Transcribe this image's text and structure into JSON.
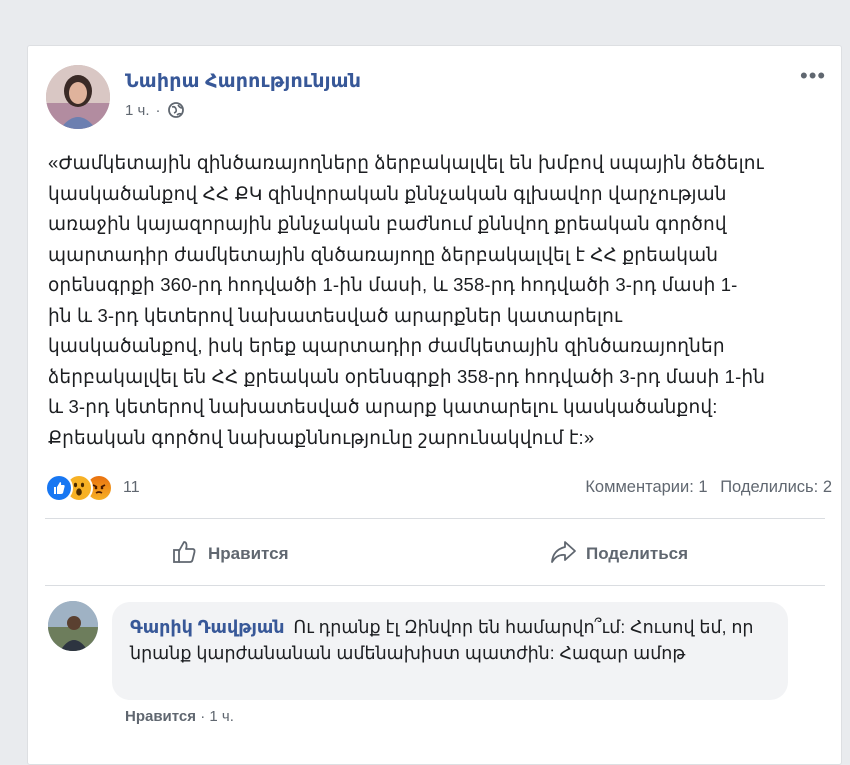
{
  "post": {
    "author": "Նաիրա Հարությունյան",
    "time": "1 ч.",
    "privacy_icon": "globe-icon",
    "more_label": "•••",
    "text": "«Ժամկետային զինծառայողները ձերբակալվել են խմբով սպային ծեծելու\nկասկածանքով ՀՀ ՔԿ զինվորական քննչական գլխավոր վարչության\nառաջին կայազորային քննչական բաժնում քննվող քրեական գործով\nպարտադիր ժամկետային զնծառայողը ձերբակալվել է ՀՀ քրեական\nօրենսգրքի 360-րդ հոդվածի 1-ին մասի, և 358-րդ հոդվածի 3-րդ մասի 1-\nին և 3-րդ կետերով նախատեսված արարքներ կատարելու\nկասկածանքով, իսկ երեք պարտադիր ժամկետային զինծառայողներ\nձերբակալվել են ՀՀ քրեական օրենսգրքի 358-րդ հոդվածի 3-րդ մասի 1-ին\nև 3-րդ կետերով նախատեսված արարք կատարելու կասկածանքով:\nՔրեական գործով նախաքննությունը շարունակվում է:»",
    "reactions": {
      "types": [
        "like",
        "wow",
        "angry"
      ],
      "count": "11"
    },
    "comments_count": "Комментарии: 1",
    "shares_count": "Поделились: 2",
    "actions": {
      "like": "Нравится",
      "share": "Поделиться"
    }
  },
  "comment": {
    "author": "Գարիկ Դավթյան",
    "text": "Ու դրանք էլ Զինվոր են համարվո՞ւմ: Հուսով եմ, որ նրանք կարժանանան ամենախիստ պատժին: Հազար ամոթ",
    "like_label": "Нравится",
    "separator": "·",
    "time": "1 ч."
  },
  "colors": {
    "link": "#385898",
    "secondary": "#606770",
    "background": "#e9ebee",
    "like_blue": "#1877f2"
  }
}
